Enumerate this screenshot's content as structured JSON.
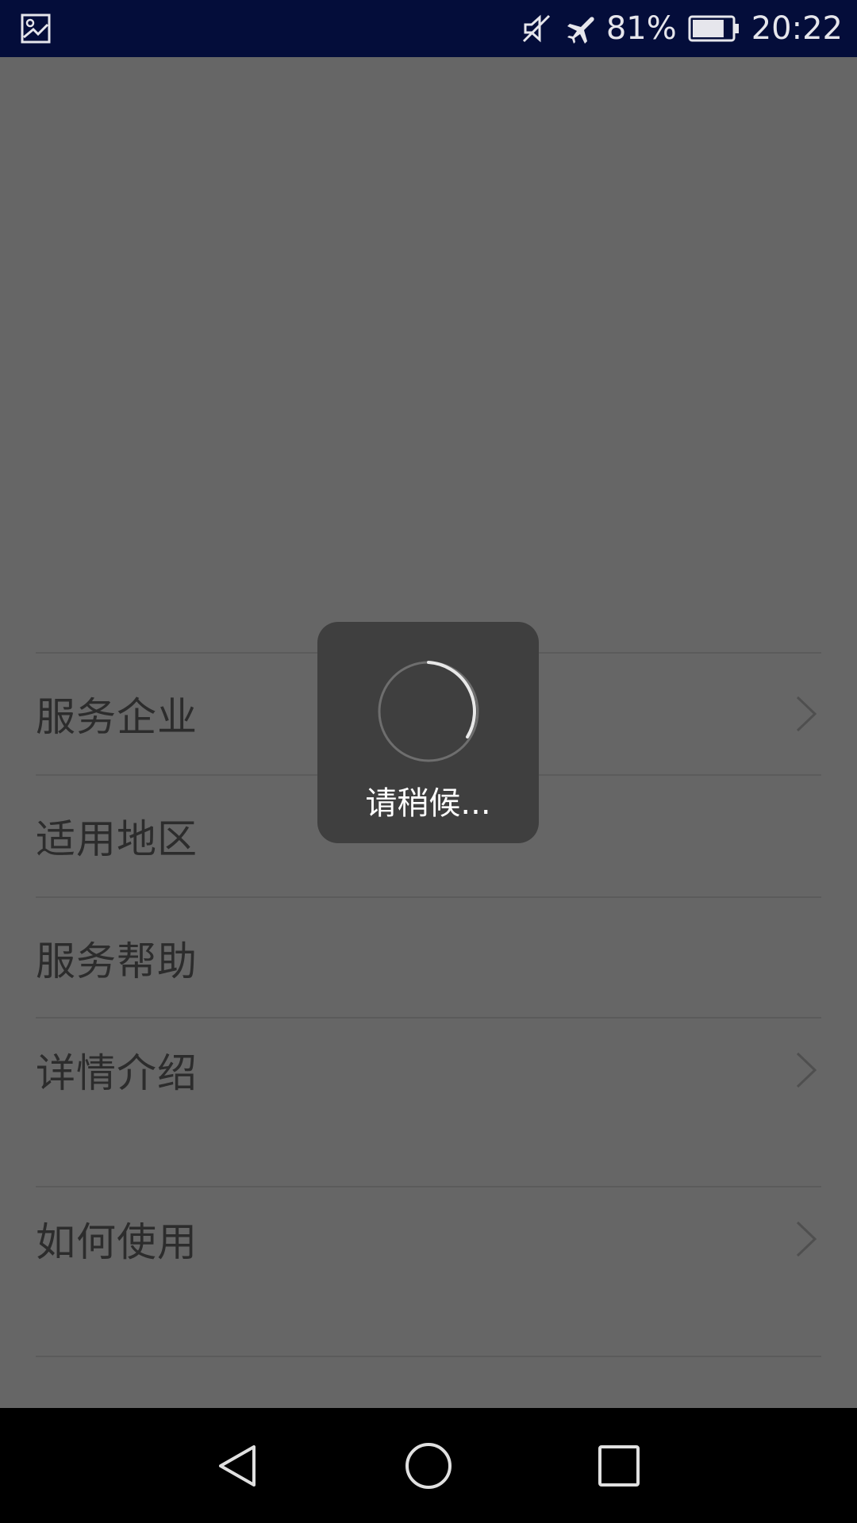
{
  "status_bar": {
    "battery_percent": "81%",
    "battery_level": 0.81,
    "time": "20:22",
    "icons": [
      "gallery-icon",
      "mute-icon",
      "airplane-mode-icon",
      "battery-icon"
    ]
  },
  "menu": {
    "items": [
      {
        "label": "服务企业",
        "has_chevron": true
      },
      {
        "label": "适用地区",
        "has_chevron": false
      },
      {
        "label": "服务帮助",
        "has_chevron": false
      },
      {
        "label": "详情介绍",
        "has_chevron": true
      },
      {
        "label": "如何使用",
        "has_chevron": true
      }
    ]
  },
  "loading": {
    "text": "请稍候..."
  },
  "nav_bar": {
    "buttons": [
      "back-icon",
      "home-icon",
      "recents-icon"
    ]
  },
  "colors": {
    "status_bar_bg": "#040d3a",
    "page_bg": "#666666",
    "dialog_bg": "#3f3f3f",
    "nav_bar_bg": "#000000"
  }
}
